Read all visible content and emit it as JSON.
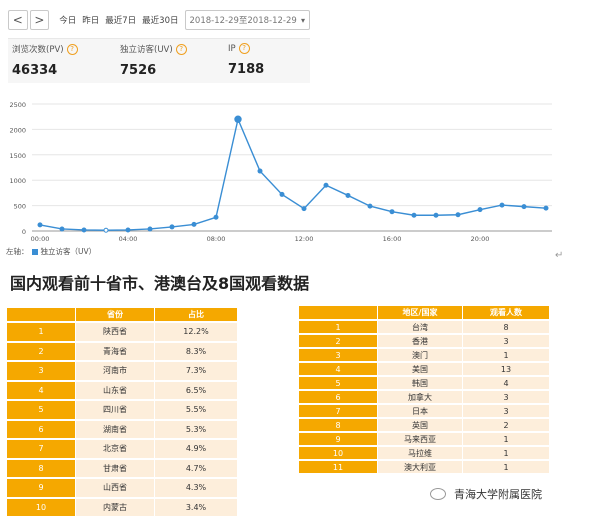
{
  "toolbar": {
    "prev": "<",
    "next": ">",
    "range_today": "今日",
    "range_yesterday": "昨日",
    "range_7d": "最近7日",
    "range_30d": "最近30日",
    "date_range": "2018-12-29至2018-12-29"
  },
  "stats": [
    {
      "label": "浏览次数(PV)",
      "value": "46334"
    },
    {
      "label": "独立访客(UV)",
      "value": "7526"
    },
    {
      "label": "IP",
      "value": "7188"
    }
  ],
  "chart_data": {
    "type": "line",
    "series": [
      {
        "name": "独立访客（UV）",
        "color": "#3a8ed4",
        "x": [
          "00:00",
          "01:00",
          "02:00",
          "03:00",
          "04:00",
          "05:00",
          "06:00",
          "07:00",
          "08:00",
          "09:00",
          "10:00",
          "11:00",
          "12:00",
          "13:00",
          "14:00",
          "15:00",
          "16:00",
          "17:00",
          "18:00",
          "19:00",
          "20:00",
          "21:00",
          "22:00",
          "23:00"
        ],
        "values": [
          120,
          40,
          20,
          15,
          20,
          40,
          80,
          130,
          270,
          2200,
          1180,
          720,
          440,
          900,
          700,
          490,
          380,
          310,
          310,
          320,
          420,
          510,
          480,
          450
        ]
      }
    ],
    "x_tick_labels": [
      "00:00",
      "04:00",
      "08:00",
      "12:00",
      "16:00",
      "20:00"
    ],
    "y_tick_labels": [
      "0",
      "500",
      "1000",
      "1500",
      "2000",
      "2500"
    ],
    "ylim": [
      0,
      2500
    ],
    "grid": true,
    "legend": "bottom-left"
  },
  "chart_legend_prefix": "左轴：",
  "chart_legend_label": "独立访客（UV）",
  "heading": "国内观看前十省市、港澳台及8国观看数据",
  "table_provinces": {
    "headers": [
      "",
      "省份",
      "占比"
    ],
    "rows": [
      [
        "1",
        "陕西省",
        "12.2%"
      ],
      [
        "2",
        "青海省",
        "8.3%"
      ],
      [
        "3",
        "河南市",
        "7.3%"
      ],
      [
        "4",
        "山东省",
        "6.5%"
      ],
      [
        "5",
        "四川省",
        "5.5%"
      ],
      [
        "6",
        "湖南省",
        "5.3%"
      ],
      [
        "7",
        "北京省",
        "4.9%"
      ],
      [
        "8",
        "甘肃省",
        "4.7%"
      ],
      [
        "9",
        "山西省",
        "4.3%"
      ],
      [
        "10",
        "内蒙古",
        "3.4%"
      ]
    ]
  },
  "table_regions": {
    "headers": [
      "",
      "地区/国家",
      "观看人数"
    ],
    "rows": [
      [
        "1",
        "台湾",
        "8"
      ],
      [
        "2",
        "香港",
        "3"
      ],
      [
        "3",
        "澳门",
        "1"
      ],
      [
        "4",
        "美国",
        "13"
      ],
      [
        "5",
        "韩国",
        "4"
      ],
      [
        "6",
        "加拿大",
        "3"
      ],
      [
        "7",
        "日本",
        "3"
      ],
      [
        "8",
        "英国",
        "2"
      ],
      [
        "9",
        "马来西亚",
        "1"
      ],
      [
        "10",
        "马拉维",
        "1"
      ],
      [
        "11",
        "澳大利亚",
        "1"
      ]
    ]
  },
  "watermark": "青海大学附属医院"
}
